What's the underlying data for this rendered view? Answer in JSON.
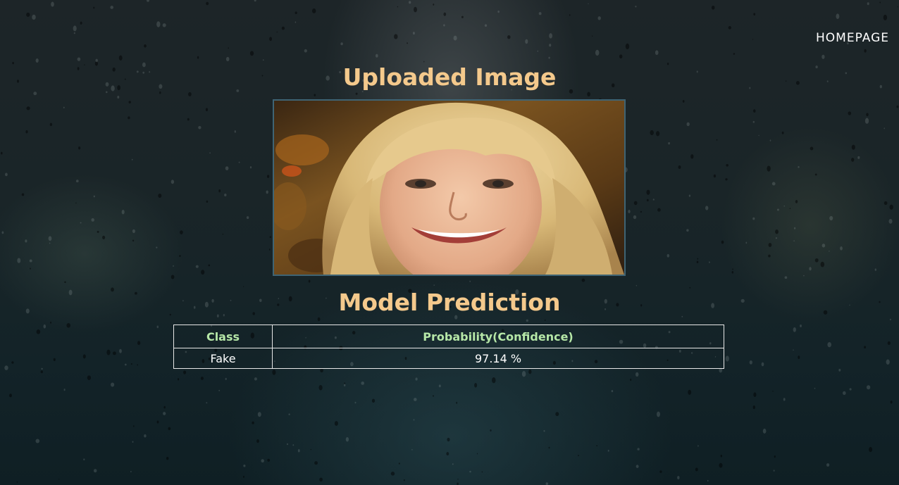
{
  "nav": {
    "homepage_label": "HOMEPAGE"
  },
  "upload_section": {
    "title": "Uploaded Image",
    "image_alt": "uploaded face photo"
  },
  "prediction_section": {
    "title": "Model Prediction",
    "table": {
      "headers": [
        "Class",
        "Probability(Confidence)"
      ],
      "rows": [
        {
          "class": "Fake",
          "probability": "97.14 %"
        }
      ]
    }
  },
  "colors": {
    "heading": "#f4c98c",
    "table_header": "#b6e7a7",
    "border": "#e8e8e8",
    "image_border": "#3f6474"
  }
}
